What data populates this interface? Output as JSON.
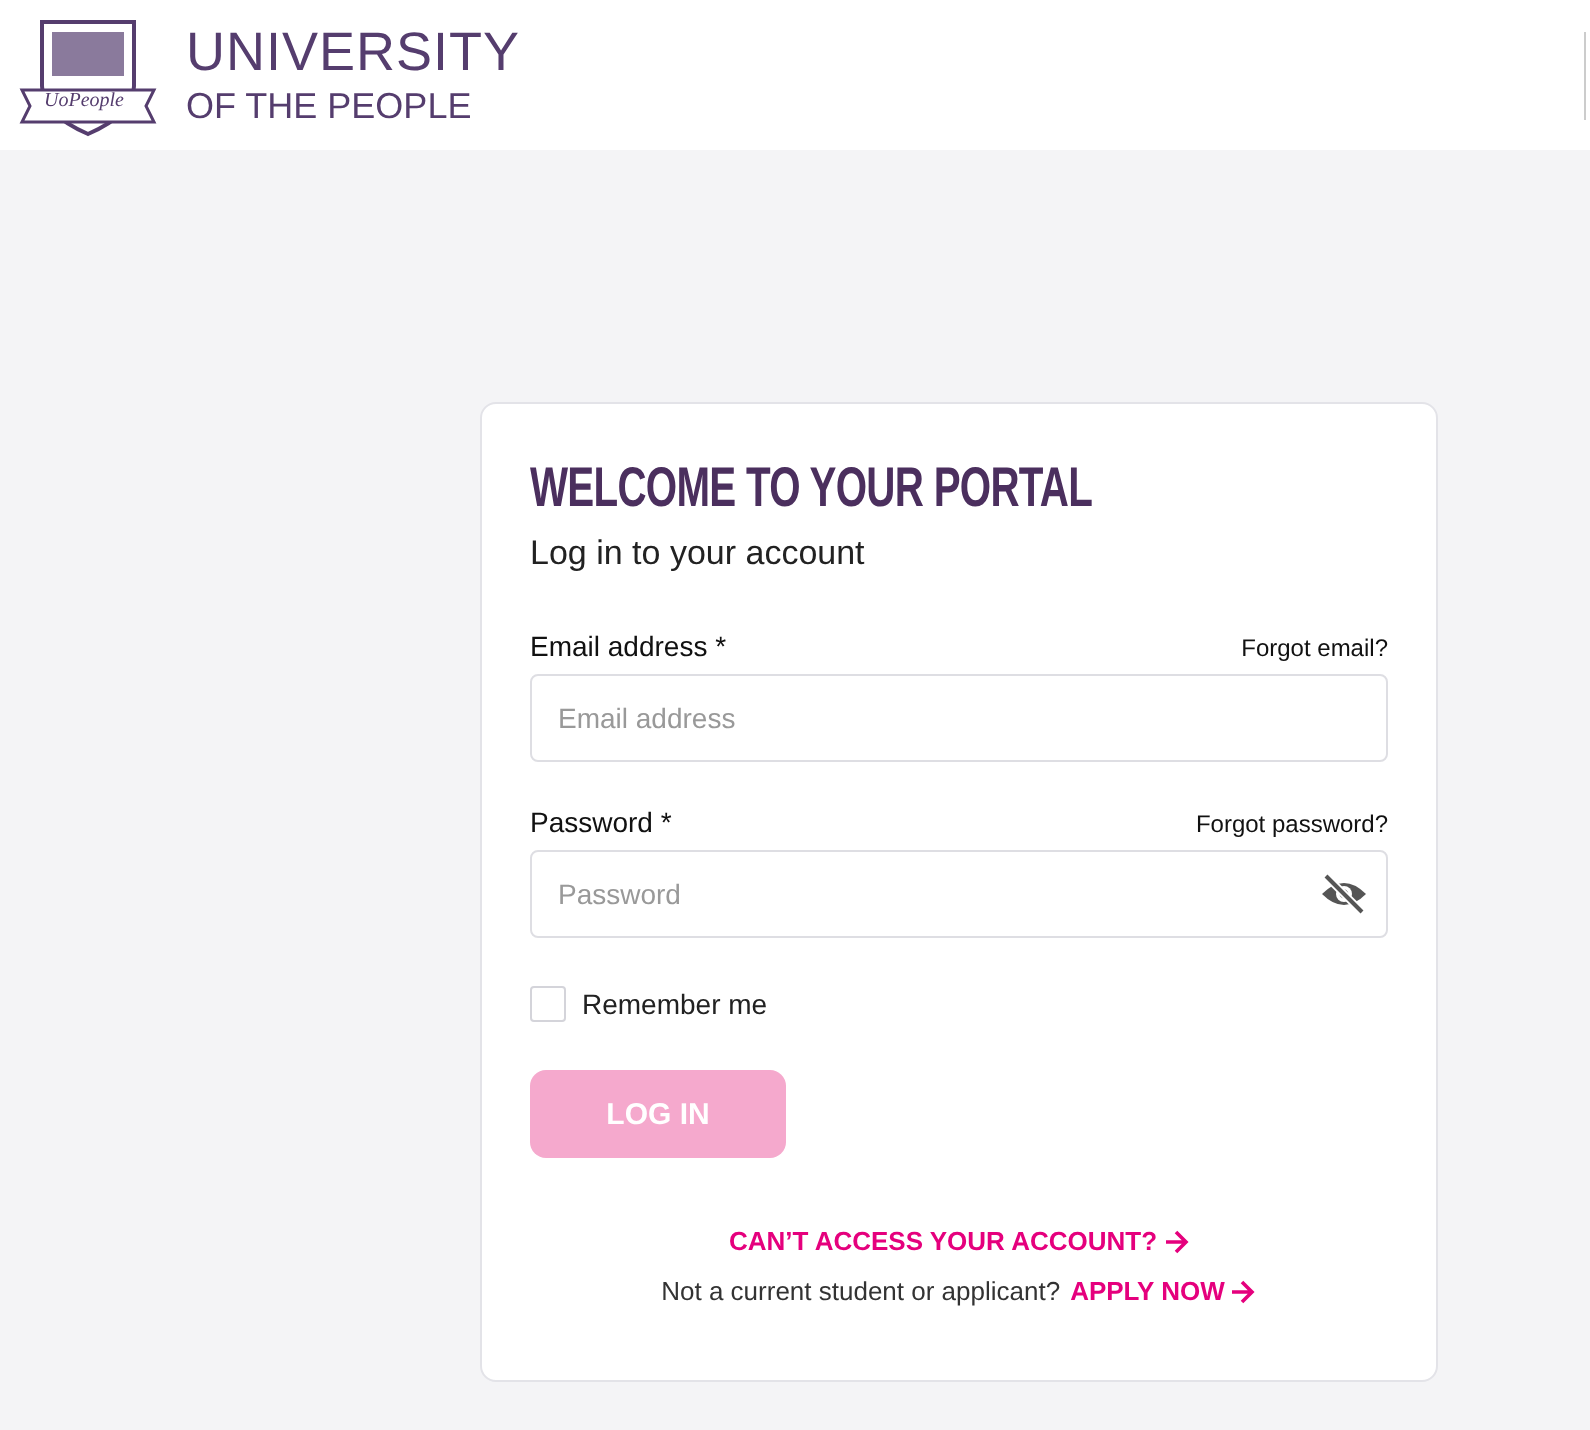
{
  "header": {
    "logo_badge": "UoPeople",
    "logo_line_1": "UNIVERSITY",
    "logo_line_2": "OF THE PEOPLE"
  },
  "card": {
    "title": "WELCOME TO YOUR PORTAL",
    "subtitle": "Log in to your account",
    "fields": [
      {
        "kind": "email",
        "label": "Email address *",
        "link": "Forgot email?",
        "placeholder": "Email address"
      },
      {
        "kind": "password",
        "label": "Password *",
        "link": "Forgot password?",
        "placeholder": "Password"
      }
    ],
    "remember": {
      "label": "Remember me",
      "checked": false
    },
    "login_button": {
      "label": "LOG IN",
      "disabled": true
    },
    "help_link": "CAN’T ACCESS YOUR ACCOUNT?",
    "apply_prompt": "Not a current student or applicant?",
    "apply_link": "APPLY NOW"
  }
}
